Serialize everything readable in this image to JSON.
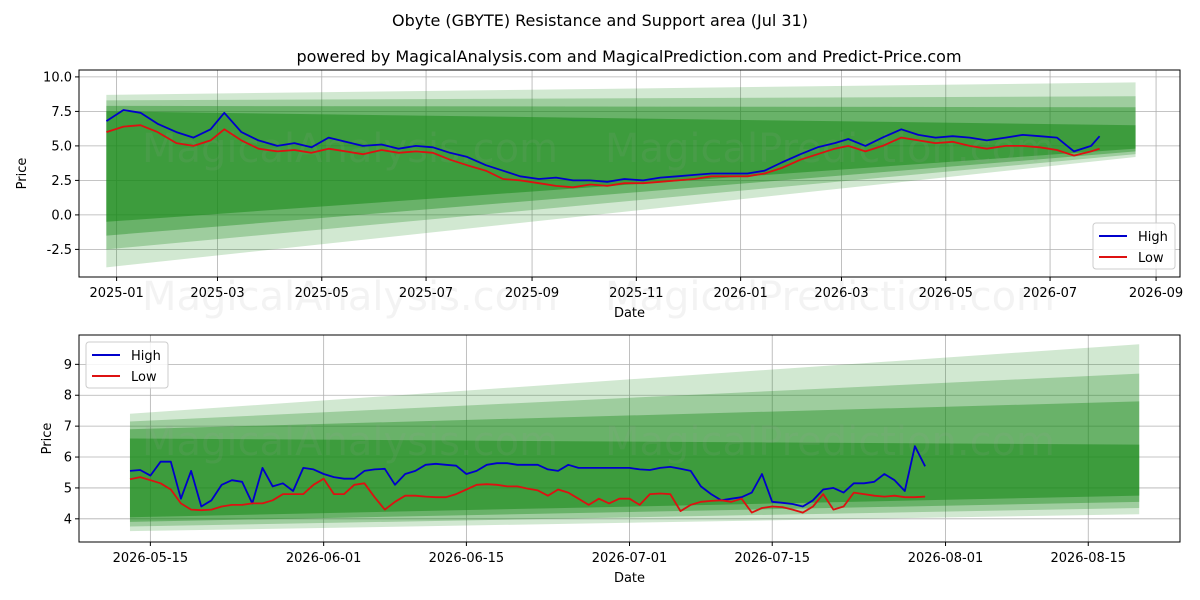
{
  "title": "Obyte (GBYTE) Resistance and Support area (Jul 31)",
  "subtitle": "powered by MagicalAnalysis.com and MagicalPrediction.com and Predict-Price.com",
  "watermarks": [
    "MagicalAnalysis.com",
    "MagicalPrediction.com"
  ],
  "colors": {
    "high": "#0000cc",
    "low": "#dd1111",
    "band": "#1a8a1a",
    "grid": "#b0b0b0"
  },
  "chart_data": [
    {
      "type": "line",
      "xlabel": "Date",
      "ylabel": "Price",
      "grid": true,
      "legend_position": "lower-right",
      "x_range": [
        "2024-12-10",
        "2026-09-15"
      ],
      "ylim": [
        -4.5,
        10.5
      ],
      "x_ticks": [
        "2025-01",
        "2025-03",
        "2025-05",
        "2025-07",
        "2025-09",
        "2025-11",
        "2026-01",
        "2026-03",
        "2026-05",
        "2026-07",
        "2026-09"
      ],
      "y_ticks": [
        -2.5,
        0.0,
        2.5,
        5.0,
        7.5,
        10.0
      ],
      "bands": {
        "x_start": "2024-12-26",
        "x_end": "2026-08-20",
        "upper_start": [
          8.7,
          8.3,
          7.9,
          7.5
        ],
        "lower_start": [
          -3.8,
          -2.5,
          -1.5,
          -0.5
        ],
        "upper_end": [
          9.6,
          8.6,
          7.8,
          6.5
        ],
        "lower_end": [
          4.2,
          4.4,
          4.6,
          4.8
        ]
      },
      "series": [
        {
          "name": "High",
          "x": [
            "2024-12-26",
            "2025-01-05",
            "2025-01-15",
            "2025-01-25",
            "2025-02-05",
            "2025-02-15",
            "2025-02-25",
            "2025-03-05",
            "2025-03-15",
            "2025-03-25",
            "2025-04-05",
            "2025-04-15",
            "2025-04-25",
            "2025-05-05",
            "2025-05-15",
            "2025-05-25",
            "2025-06-05",
            "2025-06-15",
            "2025-06-25",
            "2025-07-05",
            "2025-07-15",
            "2025-07-25",
            "2025-08-05",
            "2025-08-15",
            "2025-08-25",
            "2025-09-05",
            "2025-09-15",
            "2025-09-25",
            "2025-10-05",
            "2025-10-15",
            "2025-10-25",
            "2025-11-05",
            "2025-11-15",
            "2025-11-25",
            "2025-12-05",
            "2025-12-15",
            "2025-12-25",
            "2026-01-05",
            "2026-01-15",
            "2026-01-25",
            "2026-02-05",
            "2026-02-15",
            "2026-02-25",
            "2026-03-05",
            "2026-03-15",
            "2026-03-25",
            "2026-04-05",
            "2026-04-15",
            "2026-04-25",
            "2026-05-05",
            "2026-05-15",
            "2026-05-25",
            "2026-06-05",
            "2026-06-15",
            "2026-06-25",
            "2026-07-05",
            "2026-07-15",
            "2026-07-25",
            "2026-07-30"
          ],
          "values": [
            6.8,
            7.6,
            7.4,
            6.6,
            6.0,
            5.6,
            6.2,
            7.4,
            6.0,
            5.4,
            5.0,
            5.2,
            4.9,
            5.6,
            5.3,
            5.0,
            5.1,
            4.8,
            5.0,
            4.9,
            4.5,
            4.2,
            3.6,
            3.2,
            2.8,
            2.6,
            2.7,
            2.5,
            2.5,
            2.4,
            2.6,
            2.5,
            2.7,
            2.8,
            2.9,
            3.0,
            3.0,
            3.0,
            3.2,
            3.8,
            4.4,
            4.9,
            5.2,
            5.5,
            5.0,
            5.6,
            6.2,
            5.8,
            5.6,
            5.7,
            5.6,
            5.4,
            5.6,
            5.8,
            5.7,
            5.6,
            4.6,
            5.0,
            5.7
          ]
        },
        {
          "name": "Low",
          "x": [
            "2024-12-26",
            "2025-01-05",
            "2025-01-15",
            "2025-01-25",
            "2025-02-05",
            "2025-02-15",
            "2025-02-25",
            "2025-03-05",
            "2025-03-15",
            "2025-03-25",
            "2025-04-05",
            "2025-04-15",
            "2025-04-25",
            "2025-05-05",
            "2025-05-15",
            "2025-05-25",
            "2025-06-05",
            "2025-06-15",
            "2025-06-25",
            "2025-07-05",
            "2025-07-15",
            "2025-07-25",
            "2025-08-05",
            "2025-08-15",
            "2025-08-25",
            "2025-09-05",
            "2025-09-15",
            "2025-09-25",
            "2025-10-05",
            "2025-10-15",
            "2025-10-25",
            "2025-11-05",
            "2025-11-15",
            "2025-11-25",
            "2025-12-05",
            "2025-12-15",
            "2025-12-25",
            "2026-01-05",
            "2026-01-15",
            "2026-01-25",
            "2026-02-05",
            "2026-02-15",
            "2026-02-25",
            "2026-03-05",
            "2026-03-15",
            "2026-03-25",
            "2026-04-05",
            "2026-04-15",
            "2026-04-25",
            "2026-05-05",
            "2026-05-15",
            "2026-05-25",
            "2026-06-05",
            "2026-06-15",
            "2026-06-25",
            "2026-07-05",
            "2026-07-15",
            "2026-07-25",
            "2026-07-30"
          ],
          "values": [
            6.0,
            6.4,
            6.5,
            6.0,
            5.2,
            5.0,
            5.4,
            6.2,
            5.4,
            4.8,
            4.6,
            4.7,
            4.5,
            4.8,
            4.6,
            4.4,
            4.7,
            4.5,
            4.6,
            4.5,
            4.0,
            3.6,
            3.2,
            2.6,
            2.5,
            2.3,
            2.1,
            2.0,
            2.2,
            2.1,
            2.3,
            2.3,
            2.4,
            2.5,
            2.6,
            2.8,
            2.8,
            2.8,
            3.0,
            3.4,
            4.0,
            4.4,
            4.8,
            5.0,
            4.6,
            5.0,
            5.6,
            5.4,
            5.2,
            5.3,
            5.0,
            4.8,
            5.0,
            5.0,
            4.9,
            4.7,
            4.3,
            4.6,
            4.8
          ]
        }
      ]
    },
    {
      "type": "line",
      "xlabel": "Date",
      "ylabel": "Price",
      "grid": true,
      "legend_position": "upper-left",
      "x_range": [
        "2026-05-08",
        "2026-08-24"
      ],
      "ylim": [
        3.25,
        9.95
      ],
      "x_ticks": [
        "2026-05-15",
        "2026-06-01",
        "2026-06-15",
        "2026-07-01",
        "2026-07-15",
        "2026-08-01",
        "2026-08-15"
      ],
      "y_ticks": [
        4,
        5,
        6,
        7,
        8,
        9
      ],
      "bands": {
        "x_start": "2026-05-13",
        "x_end": "2026-08-20",
        "upper_start": [
          7.4,
          7.15,
          6.9,
          6.6
        ],
        "lower_start": [
          3.6,
          3.75,
          3.9,
          4.05
        ],
        "upper_end": [
          9.65,
          8.7,
          7.8,
          6.4
        ],
        "lower_end": [
          4.15,
          4.35,
          4.55,
          4.75
        ]
      },
      "series": [
        {
          "name": "High",
          "x": [
            "2026-05-13",
            "2026-05-14",
            "2026-05-15",
            "2026-05-16",
            "2026-05-17",
            "2026-05-18",
            "2026-05-19",
            "2026-05-20",
            "2026-05-21",
            "2026-05-22",
            "2026-05-23",
            "2026-05-24",
            "2026-05-25",
            "2026-05-26",
            "2026-05-27",
            "2026-05-28",
            "2026-05-29",
            "2026-05-30",
            "2026-05-31",
            "2026-06-01",
            "2026-06-02",
            "2026-06-03",
            "2026-06-04",
            "2026-06-05",
            "2026-06-06",
            "2026-06-07",
            "2026-06-08",
            "2026-06-09",
            "2026-06-10",
            "2026-06-11",
            "2026-06-12",
            "2026-06-13",
            "2026-06-14",
            "2026-06-15",
            "2026-06-16",
            "2026-06-17",
            "2026-06-18",
            "2026-06-19",
            "2026-06-20",
            "2026-06-21",
            "2026-06-22",
            "2026-06-23",
            "2026-06-24",
            "2026-06-25",
            "2026-06-26",
            "2026-06-27",
            "2026-06-28",
            "2026-06-29",
            "2026-06-30",
            "2026-07-01",
            "2026-07-02",
            "2026-07-03",
            "2026-07-04",
            "2026-07-05",
            "2026-07-06",
            "2026-07-07",
            "2026-07-08",
            "2026-07-09",
            "2026-07-10",
            "2026-07-11",
            "2026-07-12",
            "2026-07-13",
            "2026-07-14",
            "2026-07-15",
            "2026-07-16",
            "2026-07-17",
            "2026-07-18",
            "2026-07-19",
            "2026-07-20",
            "2026-07-21",
            "2026-07-22",
            "2026-07-23",
            "2026-07-24",
            "2026-07-25",
            "2026-07-26",
            "2026-07-27",
            "2026-07-28",
            "2026-07-29",
            "2026-07-30"
          ],
          "values": [
            5.55,
            5.58,
            5.4,
            5.85,
            5.85,
            4.65,
            5.55,
            4.4,
            4.6,
            5.1,
            5.25,
            5.2,
            4.5,
            5.65,
            5.05,
            5.15,
            4.9,
            5.65,
            5.6,
            5.45,
            5.35,
            5.3,
            5.3,
            5.55,
            5.6,
            5.62,
            5.1,
            5.45,
            5.55,
            5.75,
            5.78,
            5.75,
            5.72,
            5.45,
            5.55,
            5.75,
            5.8,
            5.8,
            5.75,
            5.75,
            5.75,
            5.6,
            5.55,
            5.75,
            5.65,
            5.65,
            5.65,
            5.65,
            5.65,
            5.65,
            5.6,
            5.58,
            5.65,
            5.68,
            5.62,
            5.55,
            5.05,
            4.8,
            4.6,
            4.65,
            4.7,
            4.85,
            5.45,
            4.55,
            4.52,
            4.48,
            4.4,
            4.6,
            4.95,
            5.0,
            4.85,
            5.15,
            5.15,
            5.2,
            5.45,
            5.25,
            4.9,
            6.35,
            5.7
          ]
        },
        {
          "name": "Low",
          "x": [
            "2026-05-13",
            "2026-05-14",
            "2026-05-15",
            "2026-05-16",
            "2026-05-17",
            "2026-05-18",
            "2026-05-19",
            "2026-05-20",
            "2026-05-21",
            "2026-05-22",
            "2026-05-23",
            "2026-05-24",
            "2026-05-25",
            "2026-05-26",
            "2026-05-27",
            "2026-05-28",
            "2026-05-29",
            "2026-05-30",
            "2026-05-31",
            "2026-06-01",
            "2026-06-02",
            "2026-06-03",
            "2026-06-04",
            "2026-06-05",
            "2026-06-06",
            "2026-06-07",
            "2026-06-08",
            "2026-06-09",
            "2026-06-10",
            "2026-06-11",
            "2026-06-12",
            "2026-06-13",
            "2026-06-14",
            "2026-06-15",
            "2026-06-16",
            "2026-06-17",
            "2026-06-18",
            "2026-06-19",
            "2026-06-20",
            "2026-06-21",
            "2026-06-22",
            "2026-06-23",
            "2026-06-24",
            "2026-06-25",
            "2026-06-26",
            "2026-06-27",
            "2026-06-28",
            "2026-06-29",
            "2026-06-30",
            "2026-07-01",
            "2026-07-02",
            "2026-07-03",
            "2026-07-04",
            "2026-07-05",
            "2026-07-06",
            "2026-07-07",
            "2026-07-08",
            "2026-07-09",
            "2026-07-10",
            "2026-07-11",
            "2026-07-12",
            "2026-07-13",
            "2026-07-14",
            "2026-07-15",
            "2026-07-16",
            "2026-07-17",
            "2026-07-18",
            "2026-07-19",
            "2026-07-20",
            "2026-07-21",
            "2026-07-22",
            "2026-07-23",
            "2026-07-24",
            "2026-07-25",
            "2026-07-26",
            "2026-07-27",
            "2026-07-28",
            "2026-07-29",
            "2026-07-30"
          ],
          "values": [
            5.28,
            5.35,
            5.25,
            5.15,
            4.95,
            4.5,
            4.3,
            4.28,
            4.3,
            4.4,
            4.45,
            4.45,
            4.5,
            4.5,
            4.6,
            4.8,
            4.8,
            4.8,
            5.1,
            5.3,
            4.8,
            4.8,
            5.1,
            5.15,
            4.7,
            4.3,
            4.55,
            4.75,
            4.75,
            4.72,
            4.7,
            4.7,
            4.8,
            4.95,
            5.1,
            5.12,
            5.1,
            5.05,
            5.05,
            4.98,
            4.92,
            4.75,
            4.95,
            4.85,
            4.65,
            4.45,
            4.65,
            4.5,
            4.65,
            4.65,
            4.45,
            4.8,
            4.82,
            4.8,
            4.25,
            4.45,
            4.55,
            4.58,
            4.6,
            4.55,
            4.65,
            4.2,
            4.35,
            4.4,
            4.38,
            4.3,
            4.2,
            4.4,
            4.8,
            4.3,
            4.4,
            4.85,
            4.8,
            4.75,
            4.72,
            4.75,
            4.7,
            4.7,
            4.72
          ]
        }
      ]
    }
  ]
}
